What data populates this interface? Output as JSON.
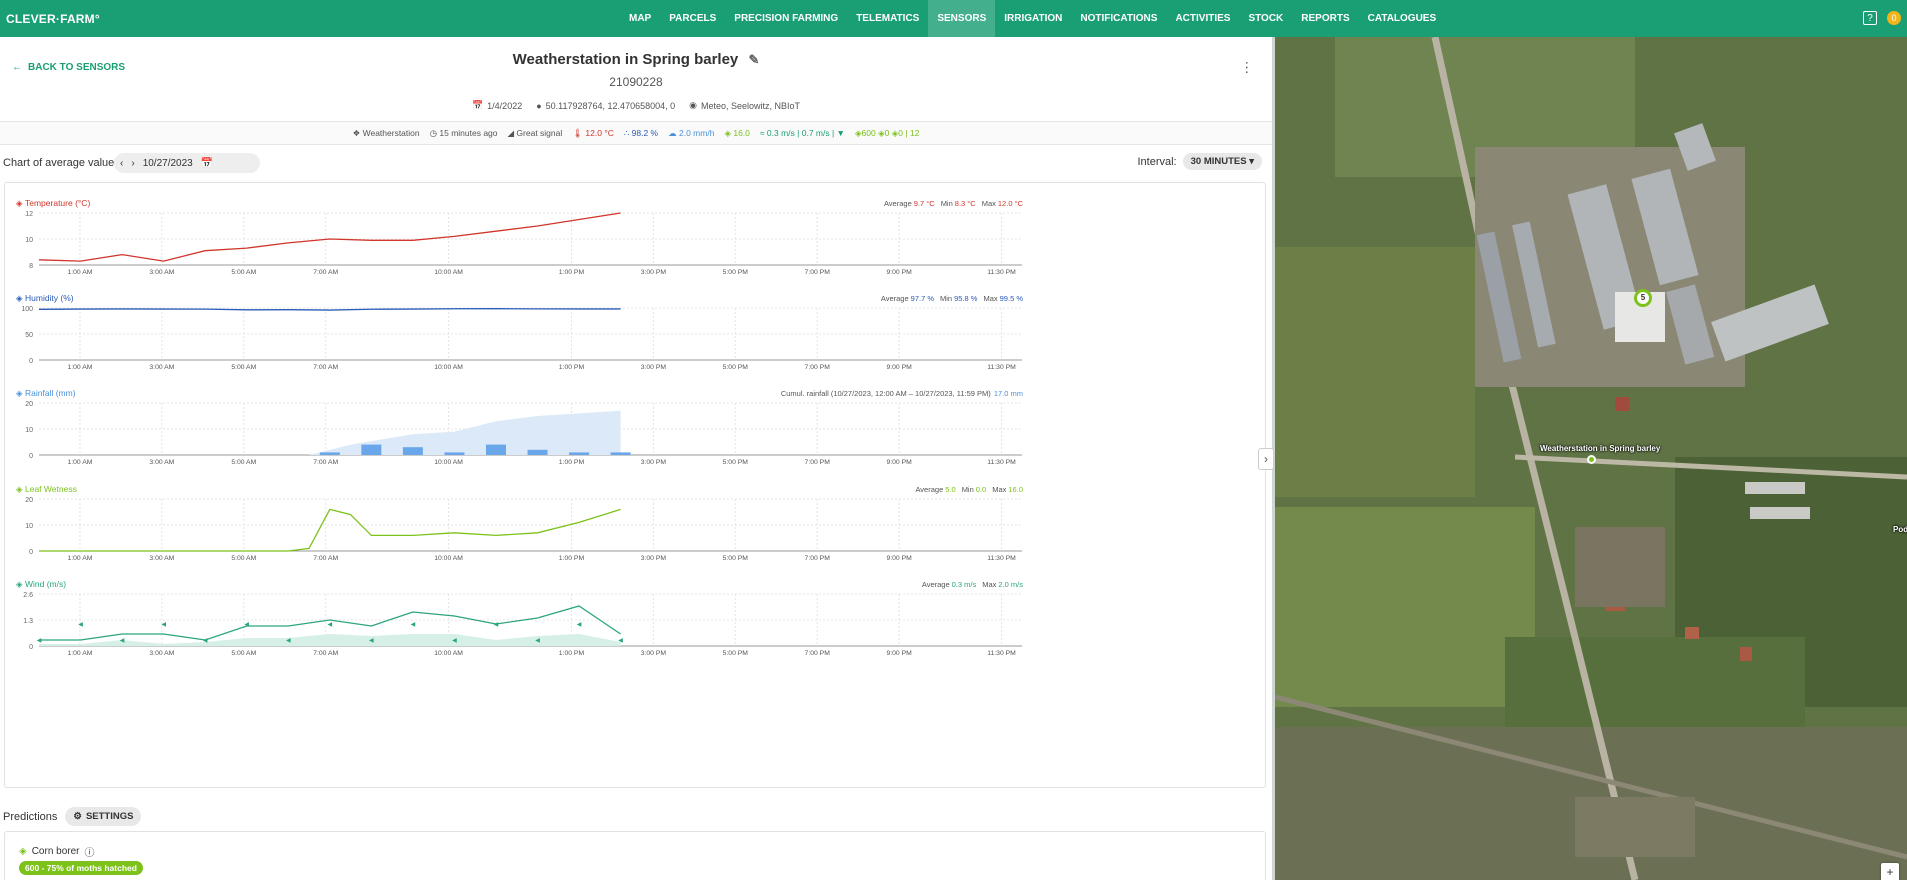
{
  "app": {
    "logo": "CLEVER·FARM°"
  },
  "nav": [
    {
      "label": "MAP",
      "active": false
    },
    {
      "label": "PARCELS",
      "active": false
    },
    {
      "label": "PRECISION FARMING",
      "active": false
    },
    {
      "label": "TELEMATICS",
      "active": false
    },
    {
      "label": "SENSORS",
      "active": true
    },
    {
      "label": "IRRIGATION",
      "active": false
    },
    {
      "label": "NOTIFICATIONS",
      "active": false
    },
    {
      "label": "ACTIVITIES",
      "active": false
    },
    {
      "label": "STOCK",
      "active": false
    },
    {
      "label": "REPORTS",
      "active": false
    },
    {
      "label": "CATALOGUES",
      "active": false
    }
  ],
  "header": {
    "help": "?",
    "notif": "0"
  },
  "page": {
    "back_label": "BACK TO SENSORS",
    "title": "Weatherstation in Spring barley",
    "id": "21090228",
    "meta_date": "1/4/2022",
    "meta_coords": "50.117928764, 12.470658004, 0",
    "meta_owner": "Meteo, Seelowitz, NBIoT"
  },
  "status": {
    "type": "Weatherstation",
    "updated": "15 minutes ago",
    "signal": "Great signal",
    "temp": "12.0 °C",
    "humidity": "98.2 %",
    "rain": "2.0 mm/h",
    "leaf": "16.0",
    "wind": "0.3 m/s",
    "wind_gust": "0.7 m/s",
    "g1": "600",
    "g2": "0",
    "g3": "0 | 12"
  },
  "chart_bar": {
    "label": "Chart of average values",
    "date": "10/27/2023",
    "interval_label": "Interval:",
    "interval_value": "30 MINUTES"
  },
  "x_ticks": [
    "1:00 AM",
    "3:00 AM",
    "5:00 AM",
    "7:00 AM",
    "10:00 AM",
    "1:00 PM",
    "3:00 PM",
    "5:00 PM",
    "7:00 PM",
    "9:00 PM",
    "11:30 PM"
  ],
  "charts": {
    "temperature": {
      "title": "Temperature (°C)",
      "stats": [
        {
          "label": "Average",
          "value": "9.7 °C"
        },
        {
          "label": "Min",
          "value": "8.3 °C"
        },
        {
          "label": "Max",
          "value": "12.0 °C"
        }
      ],
      "color": "#d1352b"
    },
    "humidity": {
      "title": "Humidity (%)",
      "stats": [
        {
          "label": "Average",
          "value": "97.7 %"
        },
        {
          "label": "Min",
          "value": "95.8 %"
        },
        {
          "label": "Max",
          "value": "99.5 %"
        }
      ],
      "color": "#2a5bb8"
    },
    "rainfall": {
      "title": "Rainfall (mm)",
      "stats_prefix": "Cumul. rainfall (10/27/2023, 12:00 AM – 10/27/2023, 11:59 PM)",
      "stats_value": "17.0 mm",
      "color": "#4a90d9"
    },
    "leaf": {
      "title": "Leaf Wetness",
      "stats": [
        {
          "label": "Average",
          "value": "5.0"
        },
        {
          "label": "Min",
          "value": "0.0"
        },
        {
          "label": "Max",
          "value": "16.0"
        }
      ],
      "color": "#7cc21b"
    },
    "wind": {
      "title": "Wind (m/s)",
      "stats": [
        {
          "label": "Average",
          "value": "0.3 m/s"
        },
        {
          "label": "Max",
          "value": "2.0 m/s"
        }
      ],
      "color": "#2aa57f"
    }
  },
  "chart_data": [
    {
      "type": "line",
      "title": "Temperature (°C)",
      "x": [
        0,
        1,
        2,
        3,
        4,
        5,
        6,
        7,
        8,
        9,
        10,
        11,
        12,
        13,
        14
      ],
      "y": [
        8.4,
        8.3,
        8.8,
        8.3,
        9.1,
        9.3,
        9.7,
        10.0,
        9.9,
        9.9,
        10.2,
        10.6,
        11.0,
        11.5,
        12.0
      ],
      "ylim": [
        8,
        12
      ],
      "yticks": [
        8,
        10,
        12
      ]
    },
    {
      "type": "line",
      "title": "Humidity (%)",
      "x": [
        0,
        1,
        2,
        3,
        4,
        5,
        6,
        7,
        8,
        9,
        10,
        11,
        12,
        13,
        14
      ],
      "y": [
        97.5,
        98,
        98.2,
        98,
        97.8,
        96.5,
        96.8,
        96,
        97.6,
        98,
        98.5,
        98.7,
        98.3,
        98.2,
        98.2
      ],
      "ylim": [
        0,
        100
      ],
      "yticks": [
        0,
        50,
        100
      ]
    },
    {
      "type": "bar",
      "title": "Rainfall (mm)",
      "bars": [
        {
          "x": 7,
          "y": 1
        },
        {
          "x": 8,
          "y": 4
        },
        {
          "x": 9,
          "y": 3
        },
        {
          "x": 10,
          "y": 1
        },
        {
          "x": 11,
          "y": 4
        },
        {
          "x": 12,
          "y": 2
        },
        {
          "x": 13,
          "y": 1
        },
        {
          "x": 14,
          "y": 1
        }
      ],
      "cumulative": [
        {
          "x": 6.5,
          "y": 0
        },
        {
          "x": 7.5,
          "y": 4
        },
        {
          "x": 9,
          "y": 8
        },
        {
          "x": 10,
          "y": 9
        },
        {
          "x": 11,
          "y": 13
        },
        {
          "x": 12,
          "y": 15
        },
        {
          "x": 13,
          "y": 16
        },
        {
          "x": 14,
          "y": 17
        }
      ],
      "ylim": [
        0,
        20
      ],
      "yticks": [
        0,
        10,
        20
      ]
    },
    {
      "type": "line",
      "title": "Leaf Wetness",
      "x": [
        0,
        1,
        2,
        3,
        4,
        5,
        6,
        6.5,
        7,
        7.5,
        8,
        9,
        10,
        11,
        12,
        13,
        14
      ],
      "y": [
        0,
        0,
        0,
        0,
        0,
        0,
        0,
        1,
        16,
        14,
        6,
        6,
        7,
        6,
        7,
        11,
        16
      ],
      "ylim": [
        0,
        20
      ],
      "yticks": [
        0,
        10,
        20
      ]
    },
    {
      "type": "line",
      "title": "Wind (m/s)",
      "x": [
        0,
        1,
        2,
        3,
        4,
        5,
        6,
        7,
        8,
        9,
        10,
        11,
        12,
        13,
        14
      ],
      "y": [
        0.3,
        0.3,
        0.6,
        0.6,
        0.3,
        1.0,
        1.0,
        1.3,
        1.0,
        1.7,
        1.5,
        1.1,
        1.4,
        2.0,
        0.6
      ],
      "area": [
        0.1,
        0.1,
        0.3,
        0.1,
        0.2,
        0.4,
        0.4,
        0.6,
        0.5,
        0.6,
        0.6,
        0.3,
        0.5,
        0.6,
        0.2
      ],
      "ylim": [
        0,
        2.6
      ],
      "yticks": [
        "0",
        "1.3",
        "2.6"
      ]
    }
  ],
  "predictions": {
    "label": "Predictions",
    "settings": "SETTINGS",
    "corn": "Corn borer",
    "badge": "600 - 75% of moths hatched"
  },
  "map": {
    "station_label": "Weatherstation in Spring barley",
    "cluster": "5",
    "edge_label": "Podr",
    "zoom_in": "+",
    "zoom_out": "−"
  }
}
